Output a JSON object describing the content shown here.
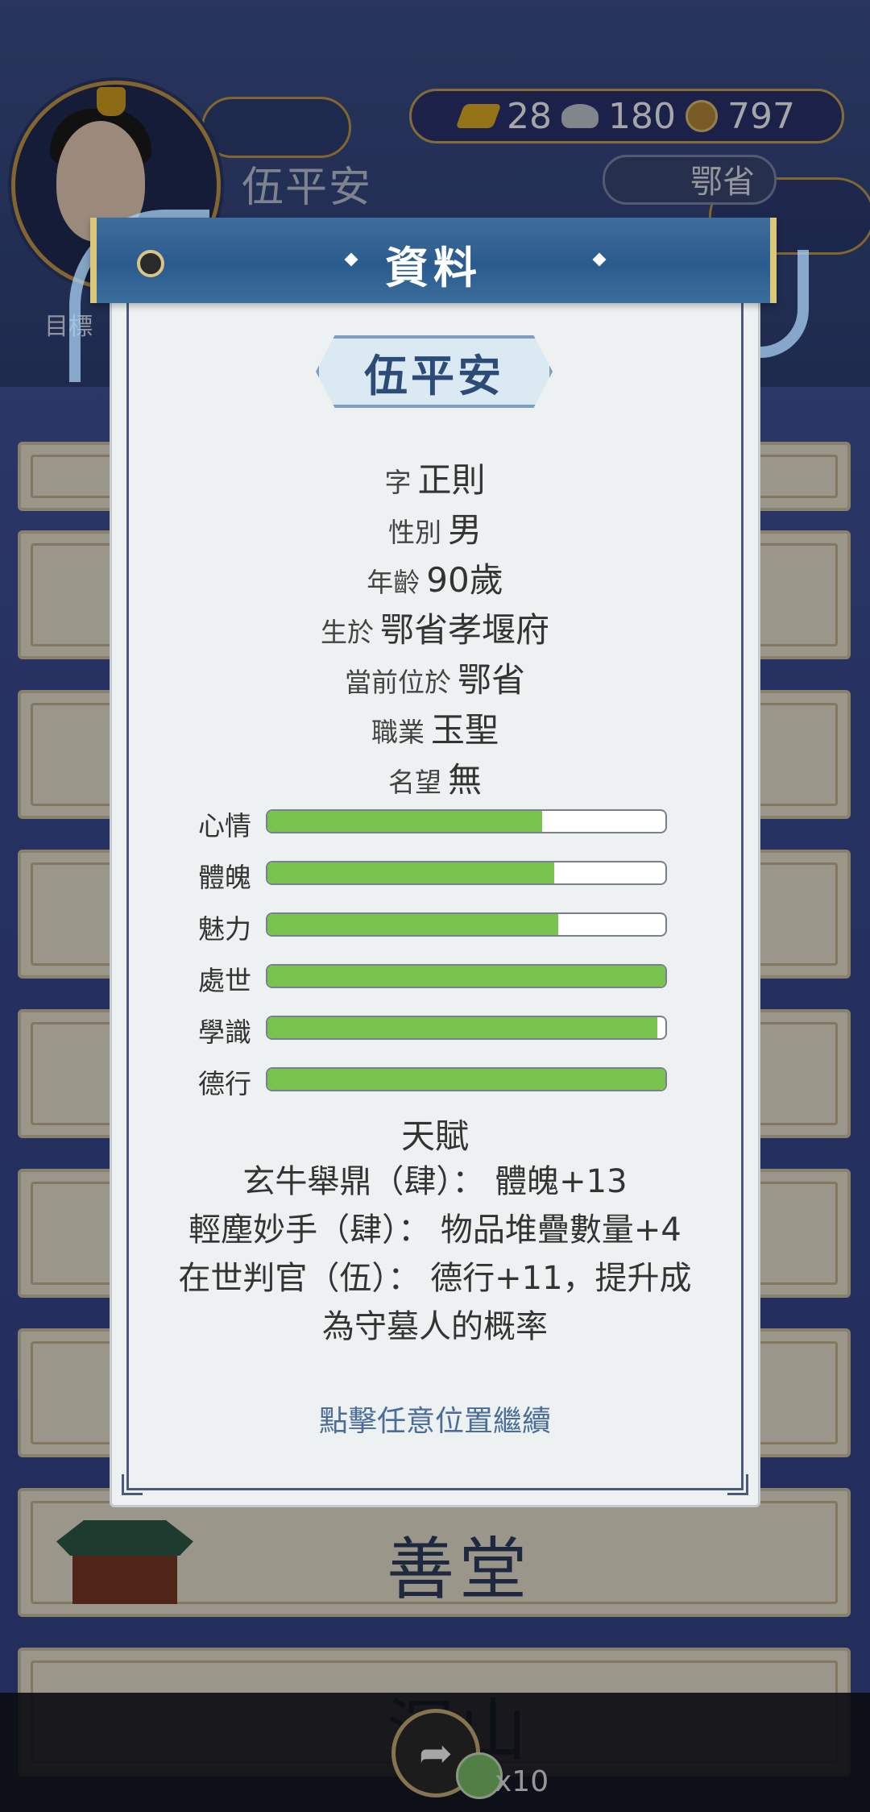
{
  "background": {
    "player_name": "伍平安",
    "currency": {
      "gold": "28",
      "silver": "180",
      "coins": "797"
    },
    "location": "鄂省",
    "goal_button": "目標",
    "rows": [
      "善堂",
      "深山"
    ],
    "bottom_bar": {
      "reward_count": "x10"
    }
  },
  "dialog": {
    "title": "資料",
    "name": "伍平安",
    "info": [
      {
        "label": "字",
        "value": "正則"
      },
      {
        "label": "性別",
        "value": "男"
      },
      {
        "label": "年齡",
        "value": "90歲"
      },
      {
        "label": "生於",
        "value": "鄂省孝堰府"
      },
      {
        "label": "當前位於",
        "value": "鄂省"
      },
      {
        "label": "職業",
        "value": "玉聖"
      },
      {
        "label": "名望",
        "value": "無"
      }
    ],
    "stats": [
      {
        "label": "心情",
        "fill": 0.69
      },
      {
        "label": "體魄",
        "fill": 0.72
      },
      {
        "label": "魅力",
        "fill": 0.73
      },
      {
        "label": "處世",
        "fill": 1.0
      },
      {
        "label": "學識",
        "fill": 0.98
      },
      {
        "label": "德行",
        "fill": 1.0
      }
    ],
    "talent_title": "天賦",
    "talents": [
      "玄牛舉鼎（肆）： 體魄+13",
      "輕塵妙手（肆）： 物品堆疊數量+4",
      "在世判官（伍）： 德行+11，提升成",
      "為守墓人的概率"
    ],
    "continue_hint": "點擊任意位置繼續"
  },
  "colors": {
    "bar_fill": "#78c34d",
    "header": "#2b5b8e",
    "accent_text": "#4a6d99"
  }
}
